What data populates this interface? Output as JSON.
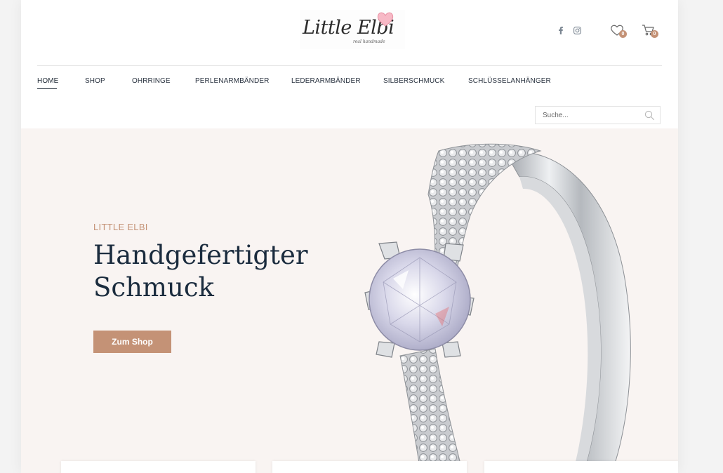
{
  "brand": {
    "logo_text": "Little Elbi",
    "logo_tagline": "real handmade",
    "accent_color": "#c49276",
    "heading_color": "#1b2c3e",
    "hero_bg": "#f9f4f2"
  },
  "header": {
    "social": [
      {
        "name": "facebook",
        "icon": "facebook-icon"
      },
      {
        "name": "instagram",
        "icon": "instagram-icon"
      }
    ],
    "wishlist_count": "0",
    "cart_count": "0"
  },
  "nav": {
    "items": [
      {
        "label": "HOME",
        "active": true
      },
      {
        "label": "SHOP"
      },
      {
        "label": "OHRRINGE"
      },
      {
        "label": "PERLENARMBÄNDER"
      },
      {
        "label": "LEDERARMBÄNDER"
      },
      {
        "label": "SILBERSCHMUCK"
      },
      {
        "label": "SCHLÜSSELANHÄNGER"
      }
    ]
  },
  "search": {
    "placeholder": "Suche...",
    "value": ""
  },
  "hero": {
    "kicker": "LITTLE ELBI",
    "title_line1": "Handgefertigter",
    "title_line2": "Schmuck",
    "button_label": "Zum Shop",
    "image": "diamond-ring-image"
  }
}
